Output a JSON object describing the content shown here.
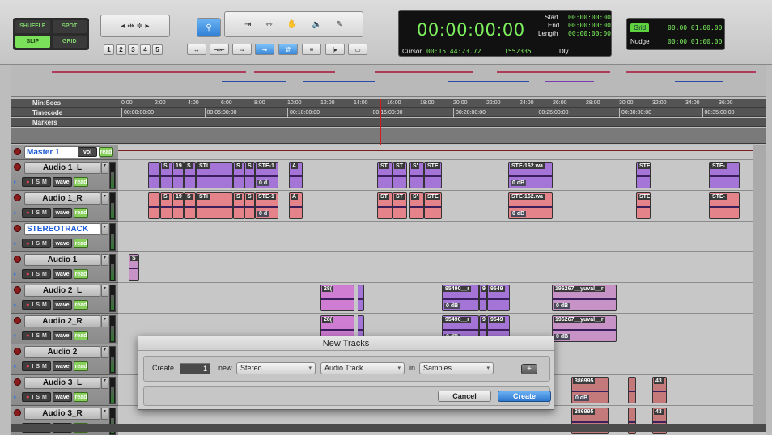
{
  "toolbar": {
    "modes": {
      "shuffle": "SHUFFLE",
      "spot": "SPOT",
      "slip": "SLIP",
      "grid": "GRID"
    },
    "num_buttons": [
      "1",
      "2",
      "3",
      "4",
      "5"
    ],
    "counter": {
      "main": "00:00:00:00",
      "start_label": "Start",
      "start_val": "00:00:00:00",
      "end_label": "End",
      "end_val": "00:00:00:00",
      "length_label": "Length",
      "length_val": "00:00:00:00",
      "cursor_label": "Cursor",
      "cursor_val": "00:15:44:23.72",
      "samples_val": "1552335",
      "dly_label": "Dly"
    },
    "grid": {
      "grid_label": "Grid",
      "grid_val": "00:00:01:00.00",
      "nudge_label": "Nudge",
      "nudge_val": "00:00:01:00.00"
    }
  },
  "rulers": {
    "minsecs_label": "Min:Secs",
    "timecode_label": "Timecode",
    "markers_label": "Markers",
    "minsecs_ticks": [
      "0:00",
      "2:00",
      "4:00",
      "6:00",
      "8:00",
      "10:00",
      "12:00",
      "14:00",
      "16:00",
      "18:00",
      "20:00",
      "22:00",
      "24:00",
      "26:00",
      "28:00",
      "30:00",
      "32:00",
      "34:00",
      "36:00"
    ],
    "timecode_ticks": [
      "00:00:00:00",
      "00:05:00:00",
      "00:10:00:00",
      "00:15:00:00",
      "00:20:00:00",
      "00:25:00:00",
      "00:30:00:00",
      "00:35:00:00"
    ]
  },
  "tracks": [
    {
      "name": "Master 1",
      "vol": "vol",
      "read": "read"
    },
    {
      "name": "Audio 1_L",
      "wave": "wave",
      "read": "read"
    },
    {
      "name": "Audio 1_R",
      "wave": "wave",
      "read": "read"
    },
    {
      "name": "STEREOTRACK",
      "wave": "wave",
      "read": "read"
    },
    {
      "name": "Audio 1",
      "wave": "wave",
      "read": "read"
    },
    {
      "name": "Audio 2_L",
      "wave": "wave",
      "read": "read"
    },
    {
      "name": "Audio 2_R",
      "wave": "wave",
      "read": "read"
    },
    {
      "name": "Audio 2",
      "wave": "wave",
      "read": "read"
    },
    {
      "name": "Audio 3_L",
      "wave": "wave",
      "read": "read"
    },
    {
      "name": "Audio 3_R",
      "wave": "wave",
      "read": "read"
    }
  ],
  "ism": {
    "i": "I",
    "s": "S",
    "m": "M"
  },
  "clips": {
    "a1": [
      "S",
      "19",
      "S",
      "STI",
      "S",
      "S",
      "STE-1",
      "A",
      "ST",
      "ST",
      "S'",
      "STE",
      "STE-162.wa",
      "STE",
      "STE-"
    ],
    "gain": "0 dB",
    "gain_short": "0 d",
    "audio1": "S",
    "a2": [
      "28(",
      "95490__r",
      "9!",
      "9549",
      "196267__yuval__r"
    ],
    "a3": [
      "386995",
      "43"
    ]
  },
  "dialog": {
    "title": "New Tracks",
    "create_label": "Create",
    "count": "1",
    "new_label": "new",
    "format": "Stereo",
    "type": "Audio Track",
    "in_label": "in",
    "timebase": "Samples",
    "cancel": "Cancel",
    "create": "Create"
  }
}
